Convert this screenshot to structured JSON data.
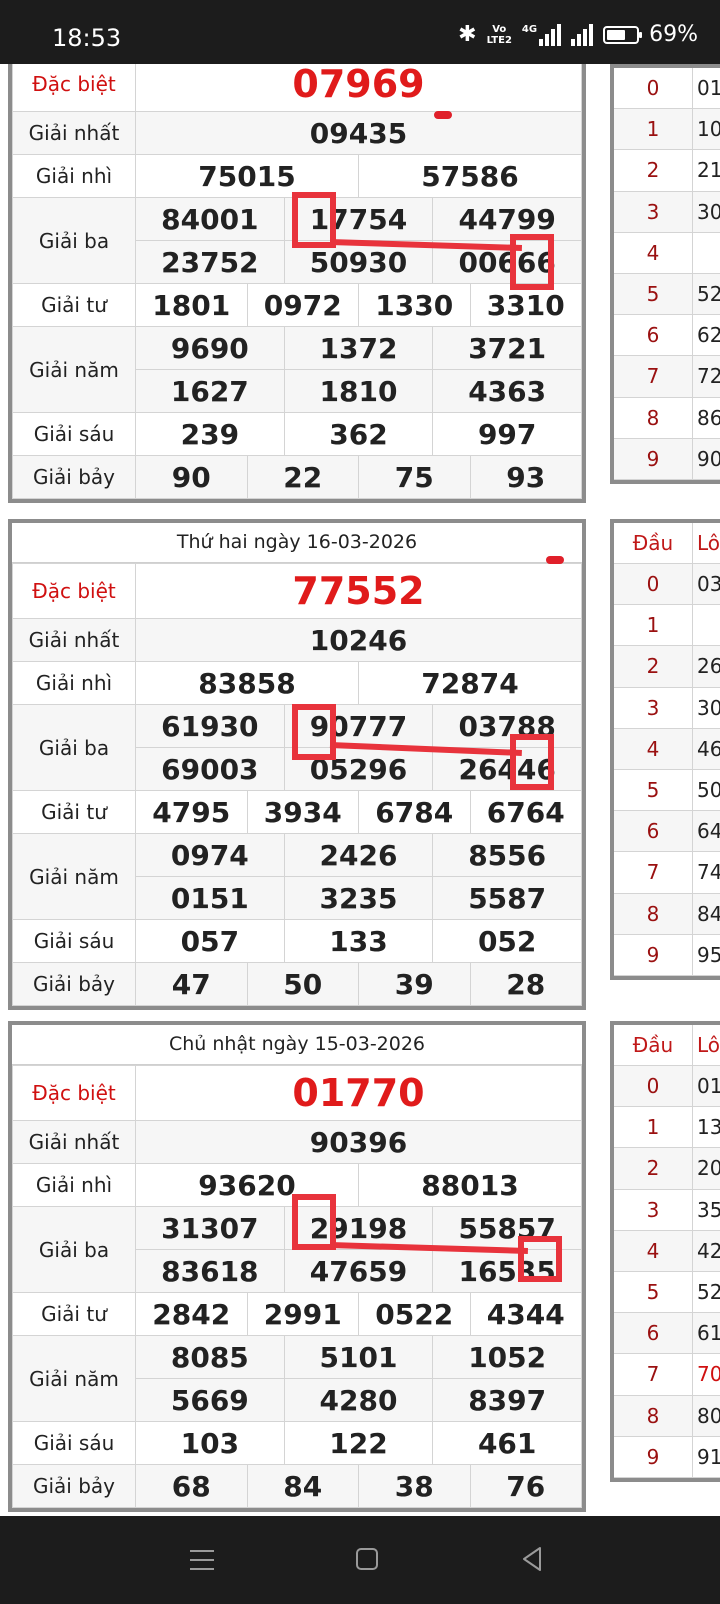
{
  "status_bar": {
    "time": "18:53",
    "network": "4G",
    "volte_top": "Vo",
    "volte_bottom": "LTE2",
    "battery": "69%",
    "battery_level": 0.69
  },
  "blocks": [
    {
      "caption": "",
      "side_has_header": false,
      "labels": {
        "db": "Đặc biệt",
        "g1": "Giải nhất",
        "g2": "Giải nhì",
        "g3": "Giải ba",
        "g4": "Giải tư",
        "g5": "Giải năm",
        "g6": "Giải sáu",
        "g7": "Giải bảy"
      },
      "db": "07969",
      "g1": "09435",
      "g2": [
        "75015",
        "57586"
      ],
      "g3": [
        [
          "84001",
          "17754",
          "44799"
        ],
        [
          "23752",
          "50930",
          "00666"
        ]
      ],
      "g4": [
        "1801",
        "0972",
        "1330",
        "3310"
      ],
      "g5": [
        [
          "9690",
          "1372",
          "3721"
        ],
        [
          "1627",
          "1810",
          "4363"
        ]
      ],
      "g6": [
        "239",
        "362",
        "997"
      ],
      "g7": [
        "90",
        "22",
        "75",
        "93"
      ],
      "loto": [
        {
          "d": "0",
          "l": "01"
        },
        {
          "d": "1",
          "l": "10"
        },
        {
          "d": "2",
          "l": "21"
        },
        {
          "d": "3",
          "l": "30"
        },
        {
          "d": "4",
          "l": ""
        },
        {
          "d": "5",
          "l": "52"
        },
        {
          "d": "6",
          "l": "62"
        },
        {
          "d": "7",
          "l": "72"
        },
        {
          "d": "8",
          "l": "86"
        },
        {
          "d": "9",
          "l": "90"
        }
      ]
    },
    {
      "caption": "Thứ hai ngày 16-03-2026",
      "side_has_header": true,
      "side_header": [
        "Đầu",
        "Lô"
      ],
      "labels": {
        "db": "Đặc biệt",
        "g1": "Giải nhất",
        "g2": "Giải nhì",
        "g3": "Giải ba",
        "g4": "Giải tư",
        "g5": "Giải năm",
        "g6": "Giải sáu",
        "g7": "Giải bảy"
      },
      "db": "77552",
      "g1": "10246",
      "g2": [
        "83858",
        "72874"
      ],
      "g3": [
        [
          "61930",
          "90777",
          "03788"
        ],
        [
          "69003",
          "05296",
          "26446"
        ]
      ],
      "g4": [
        "4795",
        "3934",
        "6784",
        "6764"
      ],
      "g5": [
        [
          "0974",
          "2426",
          "8556"
        ],
        [
          "0151",
          "3235",
          "5587"
        ]
      ],
      "g6": [
        "057",
        "133",
        "052"
      ],
      "g7": [
        "47",
        "50",
        "39",
        "28"
      ],
      "loto": [
        {
          "d": "0",
          "l": "03"
        },
        {
          "d": "1",
          "l": ""
        },
        {
          "d": "2",
          "l": "26"
        },
        {
          "d": "3",
          "l": "30"
        },
        {
          "d": "4",
          "l": "46"
        },
        {
          "d": "5",
          "l": "50"
        },
        {
          "d": "6",
          "l": "64"
        },
        {
          "d": "7",
          "l": "74"
        },
        {
          "d": "8",
          "l": "84"
        },
        {
          "d": "9",
          "l": "95"
        }
      ]
    },
    {
      "caption": "Chủ nhật ngày 15-03-2026",
      "side_has_header": true,
      "side_header": [
        "Đầu",
        "Lô"
      ],
      "labels": {
        "db": "Đặc biệt",
        "g1": "Giải nhất",
        "g2": "Giải nhì",
        "g3": "Giải ba",
        "g4": "Giải tư",
        "g5": "Giải năm",
        "g6": "Giải sáu",
        "g7": "Giải bảy"
      },
      "db": "01770",
      "g1": "90396",
      "g2": [
        "93620",
        "88013"
      ],
      "g3": [
        [
          "31307",
          "29198",
          "55857"
        ],
        [
          "83618",
          "47659",
          "16535"
        ]
      ],
      "g4": [
        "2842",
        "2991",
        "0522",
        "4344"
      ],
      "g5": [
        [
          "8085",
          "5101",
          "1052"
        ],
        [
          "5669",
          "4280",
          "8397"
        ]
      ],
      "g6": [
        "103",
        "122",
        "461"
      ],
      "g7": [
        "68",
        "84",
        "38",
        "76"
      ],
      "loto": [
        {
          "d": "0",
          "l": "01"
        },
        {
          "d": "1",
          "l": "13"
        },
        {
          "d": "2",
          "l": "20"
        },
        {
          "d": "3",
          "l": "35"
        },
        {
          "d": "4",
          "l": "42"
        },
        {
          "d": "5",
          "l": "52"
        },
        {
          "d": "6",
          "l": "61"
        },
        {
          "d": "7",
          "l": "70",
          "red": true
        },
        {
          "d": "8",
          "l": "80"
        },
        {
          "d": "9",
          "l": "91"
        }
      ]
    }
  ],
  "annotation_color": "#e8333c",
  "nav": {
    "menu": "menu-icon",
    "home": "home-icon",
    "back": "back-icon"
  }
}
